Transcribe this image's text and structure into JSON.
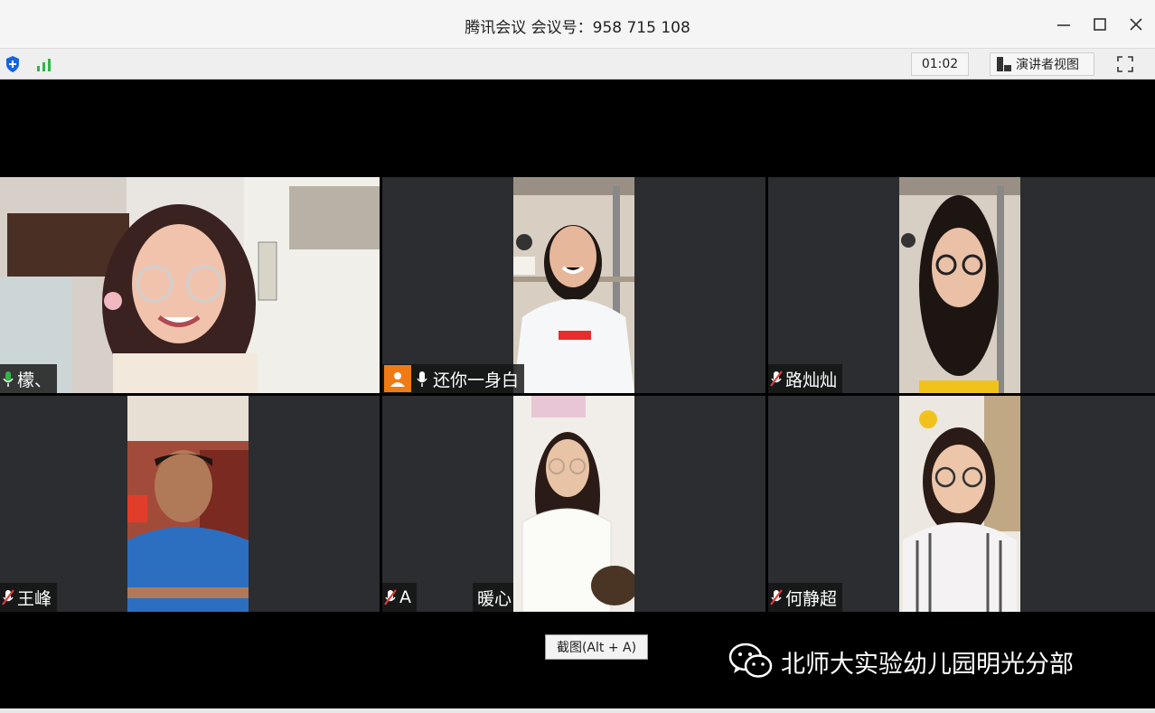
{
  "window": {
    "title": "腾讯会议 会议号：958 715 108"
  },
  "toolbar": {
    "timer": "01:02",
    "view_label": "演讲者视图"
  },
  "participants": [
    {
      "name": "檬、",
      "mic": "on",
      "active": true
    },
    {
      "name": "还你一身白",
      "mic": "on",
      "host": true
    },
    {
      "name": "路灿灿",
      "mic": "muted"
    },
    {
      "name": "王峰",
      "mic": "muted"
    },
    {
      "name": "A",
      "extra": "暖心",
      "mic": "muted"
    },
    {
      "name": "何静超",
      "mic": "muted"
    }
  ],
  "tooltip": "截图(Alt + A)",
  "watermark": "北师大实验幼儿园明光分部",
  "colors": {
    "active_border": "#3ccf5c",
    "muted_red": "#e03b3b",
    "host_badge": "#f07b14",
    "shield_blue": "#1565e0",
    "signal_green": "#2fb64a"
  }
}
